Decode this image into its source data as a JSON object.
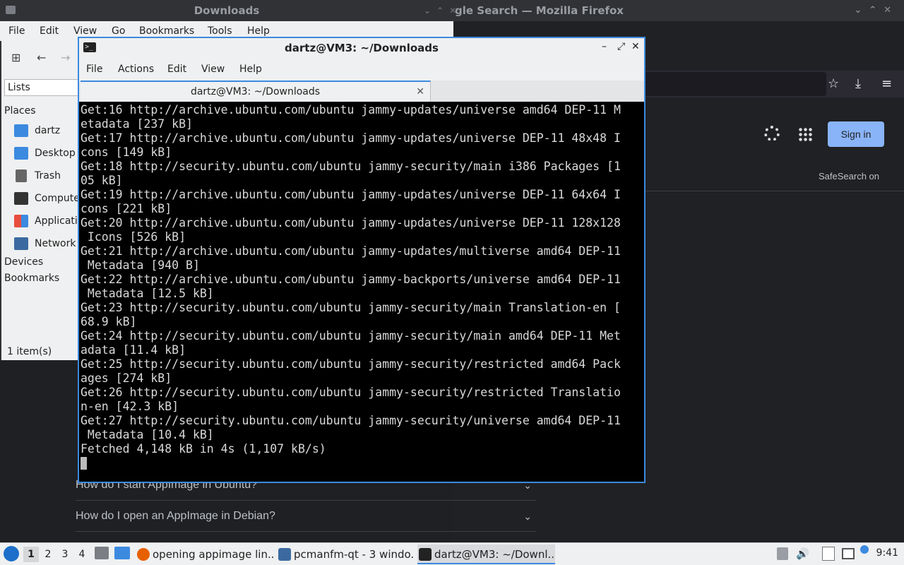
{
  "desktop": {
    "fm_window_title": "Downloads",
    "ff_window_title": "gle Search — Mozilla Firefox"
  },
  "firefox": {
    "signin_label": "Sign in",
    "safesearch_label": "SafeSearch on",
    "faq_items": [
      "How do I start AppImage in Ubuntu?",
      "How do I open an AppImage in Debian?"
    ]
  },
  "file_manager": {
    "menu": [
      "File",
      "Edit",
      "View",
      "Go",
      "Bookmarks",
      "Tools",
      "Help"
    ],
    "lists_label": "Lists",
    "places_heading": "Places",
    "places": [
      {
        "label": "dartz",
        "icon": "home-folder-icon",
        "color": "#3c8ae0"
      },
      {
        "label": "Desktop",
        "icon": "desktop-icon",
        "color": "#3c8ae0"
      },
      {
        "label": "Trash",
        "icon": "trash-icon",
        "color": "#555"
      },
      {
        "label": "Computer",
        "icon": "computer-icon",
        "color": "#333"
      },
      {
        "label": "Applications",
        "icon": "applications-icon",
        "color": "#e8a33c"
      },
      {
        "label": "Network",
        "icon": "network-icon",
        "color": "#3c6aa0"
      }
    ],
    "devices_heading": "Devices",
    "bookmarks_heading": "Bookmarks",
    "status": "1 item(s)"
  },
  "terminal": {
    "title": "dartz@VM3: ~/Downloads",
    "menu": [
      "File",
      "Actions",
      "Edit",
      "View",
      "Help"
    ],
    "tab_label": "dartz@VM3: ~/Downloads",
    "lines": [
      "Get:16 http://archive.ubuntu.com/ubuntu jammy-updates/universe amd64 DEP-11 M",
      "etadata [237 kB]",
      "Get:17 http://archive.ubuntu.com/ubuntu jammy-updates/universe DEP-11 48x48 I",
      "cons [149 kB]",
      "Get:18 http://security.ubuntu.com/ubuntu jammy-security/main i386 Packages [1",
      "05 kB]",
      "Get:19 http://archive.ubuntu.com/ubuntu jammy-updates/universe DEP-11 64x64 I",
      "cons [221 kB]",
      "Get:20 http://archive.ubuntu.com/ubuntu jammy-updates/universe DEP-11 128x128",
      " Icons [526 kB]",
      "Get:21 http://archive.ubuntu.com/ubuntu jammy-updates/multiverse amd64 DEP-11",
      " Metadata [940 B]",
      "Get:22 http://archive.ubuntu.com/ubuntu jammy-backports/universe amd64 DEP-11",
      " Metadata [12.5 kB]",
      "Get:23 http://security.ubuntu.com/ubuntu jammy-security/main Translation-en [",
      "68.9 kB]",
      "Get:24 http://security.ubuntu.com/ubuntu jammy-security/main amd64 DEP-11 Met",
      "adata [11.4 kB]",
      "Get:25 http://security.ubuntu.com/ubuntu jammy-security/restricted amd64 Pack",
      "ages [274 kB]",
      "Get:26 http://security.ubuntu.com/ubuntu jammy-security/restricted Translatio",
      "n-en [42.3 kB]",
      "Get:27 http://security.ubuntu.com/ubuntu jammy-security/universe amd64 DEP-11",
      " Metadata [10.4 kB]",
      "Fetched 4,148 kB in 4s (1,107 kB/s)"
    ]
  },
  "taskbar": {
    "workspaces": [
      "1",
      "2",
      "3",
      "4"
    ],
    "tasks": [
      {
        "label": "opening appimage lin...",
        "icon": "firefox-icon",
        "color": "#e66000"
      },
      {
        "label": "pcmanfm-qt - 3 windo...",
        "icon": "folder-icon",
        "color": "#3c6aa0"
      },
      {
        "label": "dartz@VM3: ~/Downl...",
        "icon": "terminal-icon",
        "color": "#222"
      }
    ],
    "clock": "9:41"
  }
}
